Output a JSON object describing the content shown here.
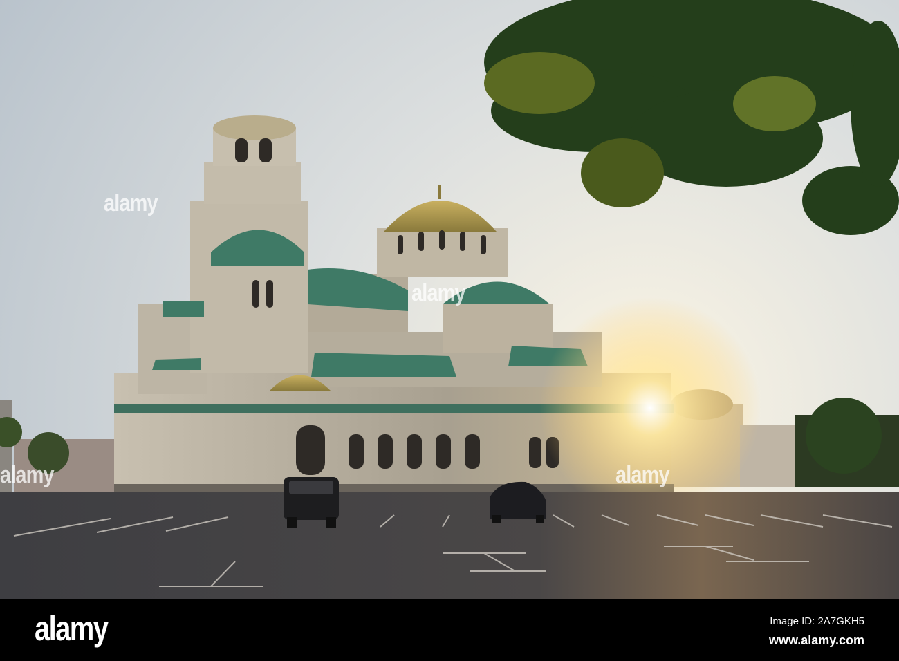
{
  "photo": {
    "subject": "Alexander Nevsky Cathedral at sunset",
    "colors": {
      "sky": "#c8ced3",
      "sun": "#fff6d8",
      "stone": "#b7ad9c",
      "dome_gold": "#b49a4a",
      "dome_green": "#3f7a66",
      "ground": "#47474a",
      "foliage": "#24401c"
    }
  },
  "watermark": {
    "text": "alamy"
  },
  "footer": {
    "logo": "alamy",
    "image_id": "Image ID: 2A7GKH5",
    "url": "www.alamy.com"
  }
}
